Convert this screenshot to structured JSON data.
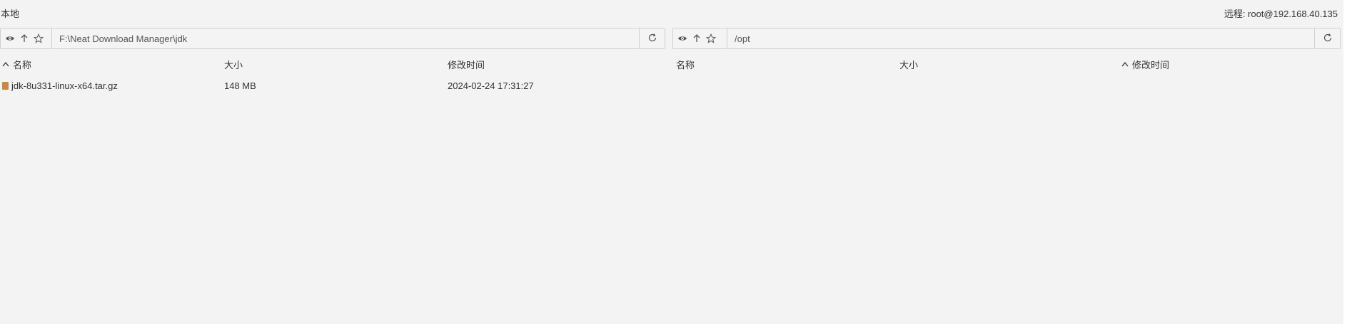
{
  "local_label": "本地",
  "remote_label": "远程: root@192.168.40.135",
  "left_pane": {
    "path": "F:\\Neat Download Manager\\jdk",
    "columns": {
      "name": "名称",
      "size": "大小",
      "modified": "修改时间"
    },
    "sort_column": "name",
    "files": [
      {
        "name": "jdk-8u331-linux-x64.tar.gz",
        "size": "148 MB",
        "modified": "2024-02-24 17:31:27"
      }
    ]
  },
  "right_pane": {
    "path": "/opt",
    "columns": {
      "name": "名称",
      "size": "大小",
      "modified": "修改时间"
    },
    "sort_column": "modified",
    "files": []
  },
  "icons": {
    "view": "eye-icon",
    "up": "arrow-up-icon",
    "bookmark": "star-icon",
    "refresh": "refresh-icon",
    "sort": "chevron-up-icon",
    "file": "archive-file-icon"
  }
}
